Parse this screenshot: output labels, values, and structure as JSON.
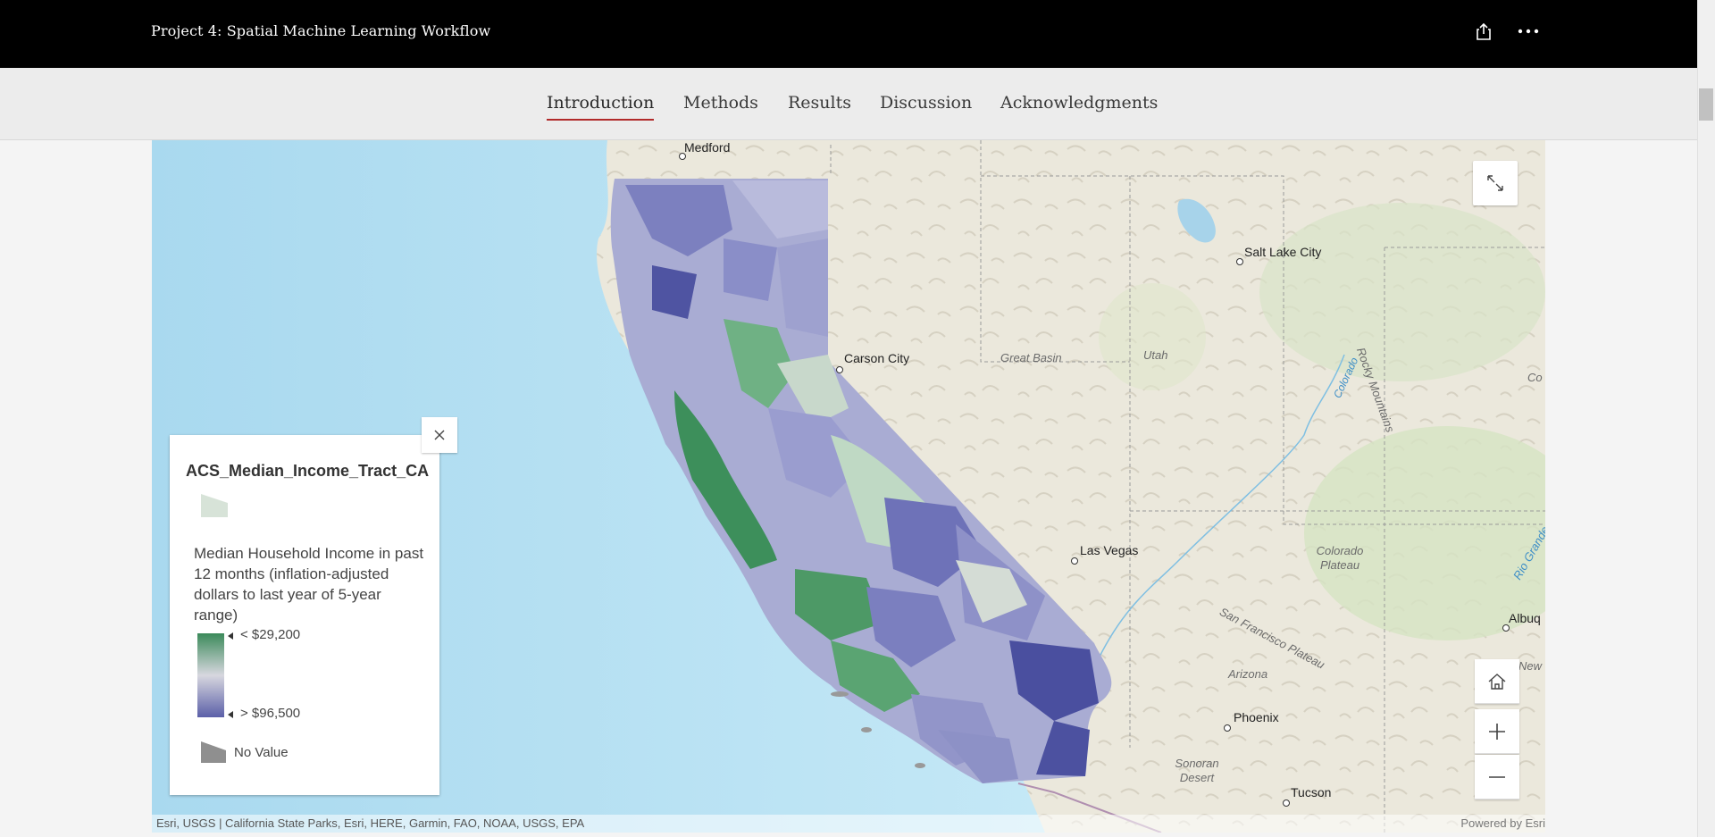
{
  "header": {
    "title": "Project 4: Spatial Machine Learning Workflow",
    "share_icon": "share-icon",
    "more_icon": "more-options-icon"
  },
  "nav": {
    "tabs": [
      {
        "label": "Introduction",
        "active": true
      },
      {
        "label": "Methods",
        "active": false
      },
      {
        "label": "Results",
        "active": false
      },
      {
        "label": "Discussion",
        "active": false
      },
      {
        "label": "Acknowledgments",
        "active": false
      }
    ]
  },
  "map": {
    "labels": {
      "medford": "Medford",
      "salt_lake_city": "Salt Lake City",
      "carson_city": "Carson City",
      "great_basin": "Great Basin",
      "utah": "Utah",
      "rocky_mountains": "Rocky Mountains",
      "colorado_river": "Colorado",
      "las_vegas": "Las Vegas",
      "colorado_plateau": "Colorado Plateau",
      "san_francisco_plateau": "San Francisco Plateau",
      "arizona": "Arizona",
      "phoenix": "Phoenix",
      "sonoran_desert": "Sonoran Desert",
      "tucson": "Tucson",
      "albuquerque": "Albuq",
      "new_mexico": "New Me",
      "rio_grande": "Rio Grande",
      "co_partial": "Co"
    },
    "attribution": "Esri, USGS | California State Parks, Esri, HERE, Garmin, FAO, NOAA, USGS, EPA",
    "powered_by": "Powered by Esri"
  },
  "legend": {
    "layer_title": "ACS_Median_Income_Tract_CA",
    "field_description": "Median Household Income in past 12 months (inflation-adjusted dollars to last year of 5-year range)",
    "high_label": "< $29,200",
    "low_label": "> $96,500",
    "no_value_label": "No Value",
    "colors": {
      "high": "#3b8a5a",
      "mid": "#d7d7df",
      "low": "#5b5fa8",
      "no_value": "#8f8f8f"
    }
  },
  "icons": {
    "expand": "expand-icon",
    "home": "home-icon",
    "zoom_in": "zoom-in-icon",
    "zoom_out": "zoom-out-icon",
    "close": "close-icon"
  }
}
